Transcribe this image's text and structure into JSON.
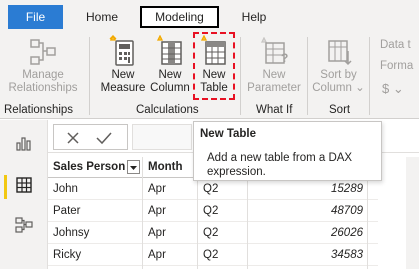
{
  "tabs": {
    "file": "File",
    "home": "Home",
    "modeling": "Modeling",
    "help": "Help"
  },
  "ribbon": {
    "relationships_group": {
      "manage_line1": "Manage",
      "manage_line2": "Relationships",
      "label": "Relationships"
    },
    "calculations_group": {
      "new_measure_line1": "New",
      "new_measure_line2": "Measure",
      "new_column_line1": "New",
      "new_column_line2": "Column",
      "new_table_line1": "New",
      "new_table_line2": "Table",
      "label": "Calculations"
    },
    "whatif_group": {
      "new_parameter_line1": "New",
      "new_parameter_line2": "Parameter",
      "label": "What If"
    },
    "sort_group": {
      "sort_line1": "Sort by",
      "sort_line2": "Column",
      "label": "Sort"
    },
    "formatting_partial": {
      "data_type": "Data t",
      "format": "Forma",
      "currency": "$"
    }
  },
  "tooltip": {
    "title": "New Table",
    "description": "Add a new table from a DAX expression."
  },
  "table": {
    "headers": [
      "Sales Person",
      "Month",
      "",
      ""
    ],
    "rows": [
      [
        "John",
        "Apr",
        "Q2",
        "15289"
      ],
      [
        "Pater",
        "Apr",
        "Q2",
        "48709"
      ],
      [
        "Johnsy",
        "Apr",
        "Q2",
        "26026"
      ],
      [
        "Ricky",
        "Apr",
        "Q2",
        "34583"
      ],
      [
        "",
        "",
        "",
        ""
      ]
    ]
  },
  "colors": {
    "file_tab": "#2b7cd3",
    "highlight_border": "#e81123",
    "active_nav": "#f2c811"
  }
}
